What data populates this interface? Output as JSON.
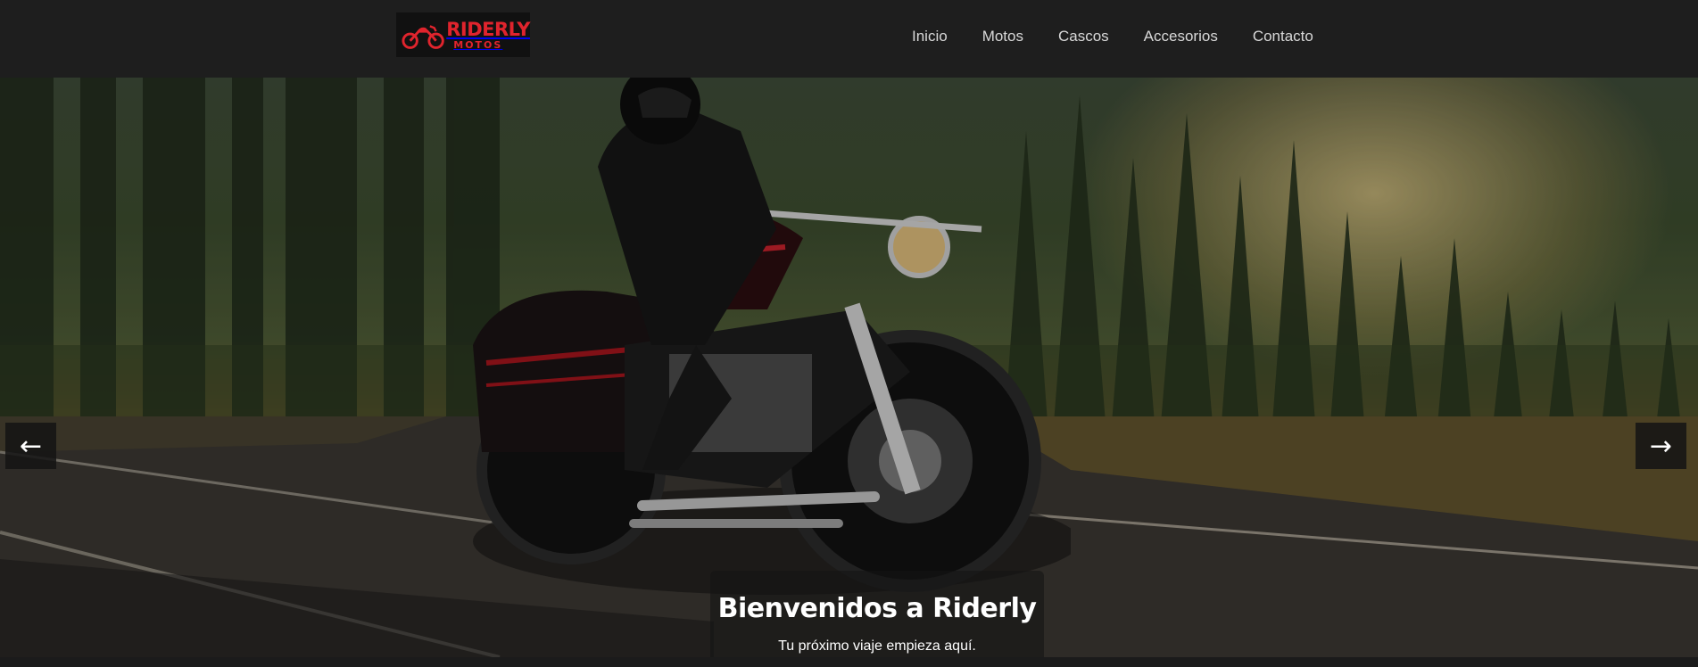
{
  "header": {
    "logo": {
      "main": "RIDERLY",
      "sub": "MOTOS",
      "icon": "motorcycle-icon",
      "color": "#e0242d"
    },
    "nav": [
      {
        "label": "Inicio"
      },
      {
        "label": "Motos"
      },
      {
        "label": "Cascos"
      },
      {
        "label": "Accesorios"
      },
      {
        "label": "Contacto"
      }
    ]
  },
  "hero": {
    "title": "Bienvenidos a Riderly",
    "subtitle": "Tu próximo viaje empieza aquí.",
    "prev_arrow": "←",
    "next_arrow": "→",
    "image": "motorcycle-rider-on-forest-road-at-sunset"
  },
  "colors": {
    "background": "#1b1b1b",
    "header": "#1e1e1e",
    "accent": "#e0242d"
  }
}
